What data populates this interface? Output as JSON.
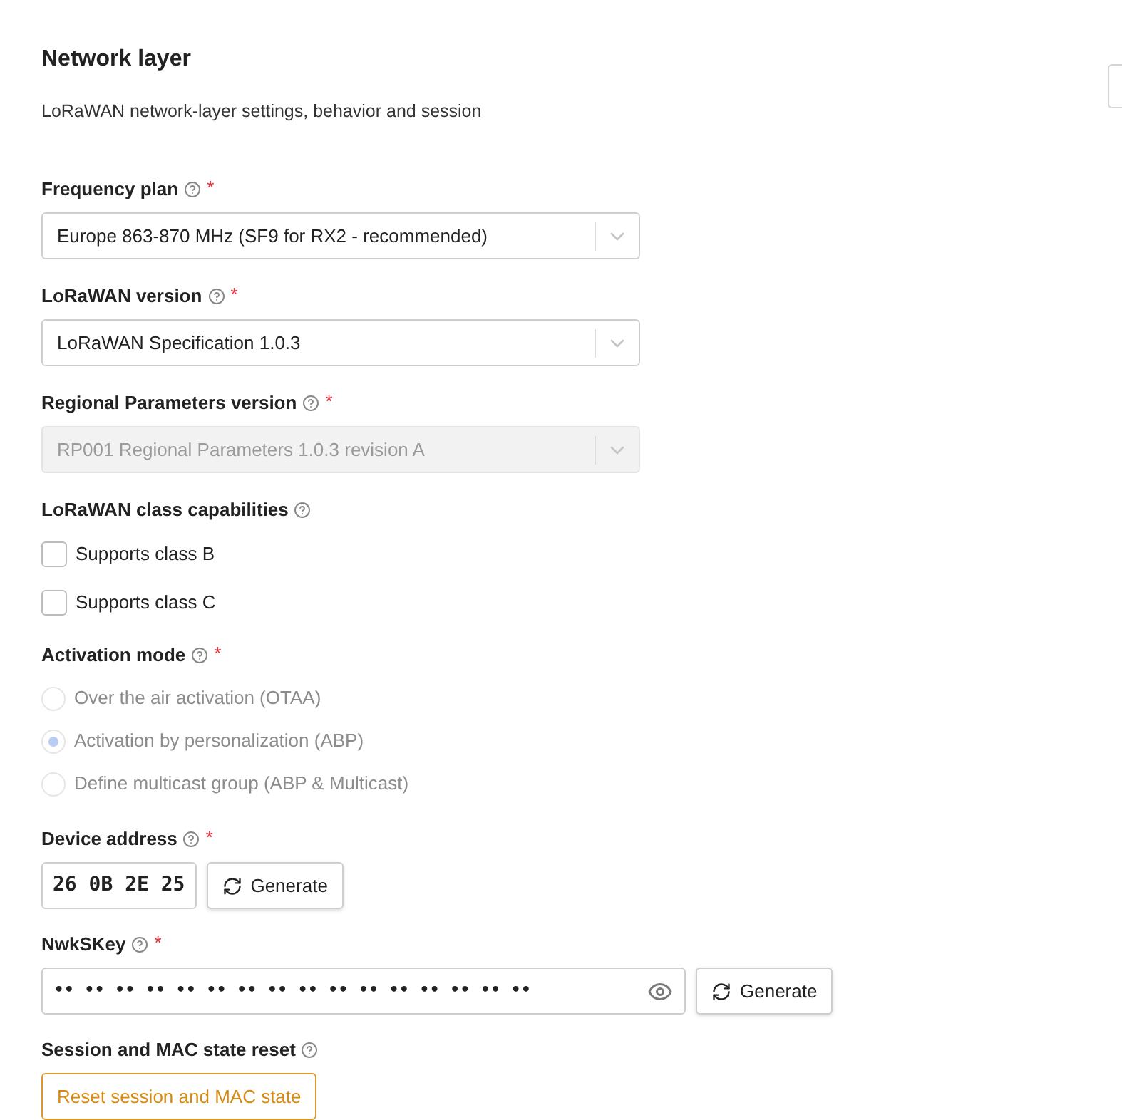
{
  "section": {
    "title": "Network layer",
    "description": "LoRaWAN network-layer settings, behavior and session"
  },
  "fields": [
    {
      "kind": "select",
      "label": "Frequency plan",
      "required": "*",
      "help": true,
      "value": "Europe 863-870 MHz (SF9 for RX2 - recommended)",
      "disabled": false
    },
    {
      "kind": "select",
      "label": "LoRaWAN version",
      "required": "*",
      "help": true,
      "value": "LoRaWAN Specification 1.0.3",
      "disabled": false
    },
    {
      "kind": "select",
      "label": "Regional Parameters version",
      "required": "*",
      "help": true,
      "value": "RP001 Regional Parameters 1.0.3 revision A",
      "disabled": true
    },
    {
      "kind": "checkboxes",
      "label": "LoRaWAN class capabilities",
      "help": true,
      "options": [
        {
          "label": "Supports class B",
          "checked": false
        },
        {
          "label": "Supports class C",
          "checked": false
        }
      ]
    },
    {
      "kind": "radios",
      "label": "Activation mode",
      "required": "*",
      "help": true,
      "options": [
        {
          "label": "Over the air activation (OTAA)",
          "selected": false,
          "disabled": true
        },
        {
          "label": "Activation by personalization (ABP)",
          "selected": true,
          "disabled": true
        },
        {
          "label": "Define multicast group (ABP & Multicast)",
          "selected": false,
          "disabled": true
        }
      ]
    },
    {
      "kind": "hex",
      "label": "Device address",
      "required": "*",
      "help": true,
      "value": "26 0B 2E 25",
      "button": "Generate"
    },
    {
      "kind": "secret",
      "label": "NwkSKey",
      "required": "*",
      "help": true,
      "value": "•• •• •• •• •• •• •• •• •• •• •• •• •• •• •• ••",
      "button": "Generate"
    },
    {
      "kind": "action",
      "label": "Session and MAC state reset",
      "help": true,
      "button": "Reset session and MAC state"
    }
  ]
}
